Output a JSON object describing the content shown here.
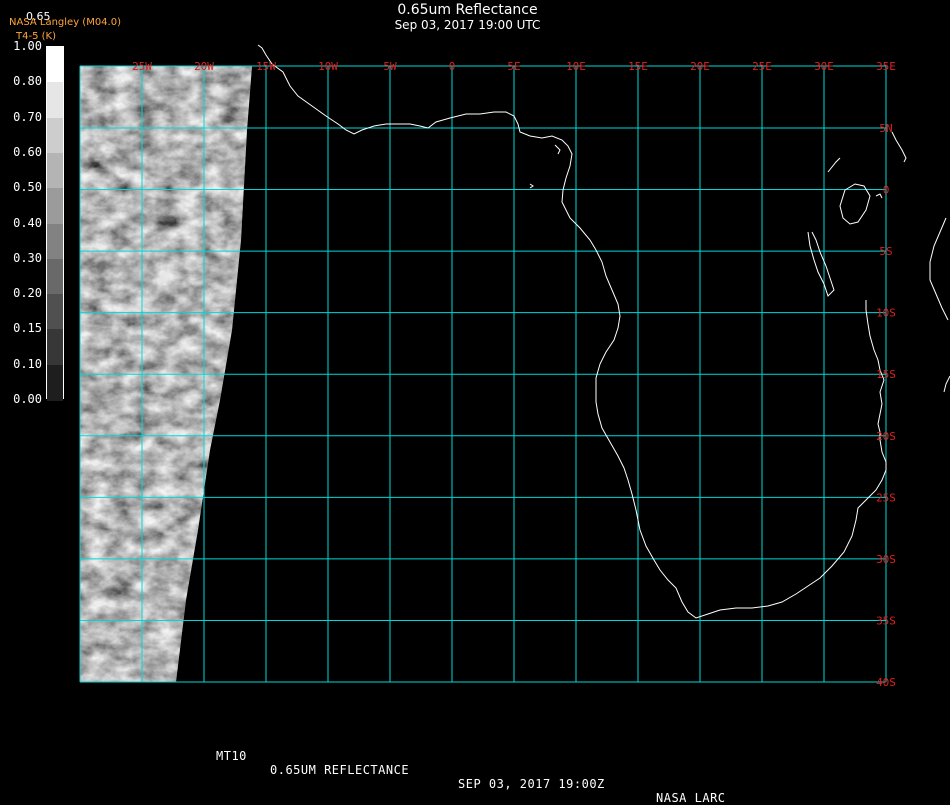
{
  "header": {
    "title": "0.65um Reflectance",
    "datetime": "Sep 03, 2017 19:00 UTC"
  },
  "credits": {
    "line0": "0.65",
    "line1": "NASA Langley (M04.0)",
    "line2": "T4-5 (K)"
  },
  "colorbar": {
    "labels": [
      "1.00",
      "0.80",
      "0.70",
      "0.60",
      "0.50",
      "0.40",
      "0.30",
      "0.20",
      "0.15",
      "0.10",
      "0.00"
    ]
  },
  "map": {
    "lon_labels": [
      "25W",
      "20W",
      "15W",
      "10W",
      "5W",
      "0",
      "5E",
      "10E",
      "15E",
      "20E",
      "25E",
      "30E",
      "35E"
    ],
    "lat_labels": [
      "5N",
      "0",
      "5S",
      "10S",
      "15S",
      "20S",
      "25S",
      "30S",
      "35S",
      "40S"
    ],
    "grid_color": "#00d8d8",
    "label_color": "#e02020",
    "coast_color": "#ffffff"
  },
  "footer": {
    "product": "MT10",
    "channel": "0.65UM REFLECTANCE",
    "date": "SEP 03, 2017 19:00Z",
    "source": "NASA LARC"
  }
}
